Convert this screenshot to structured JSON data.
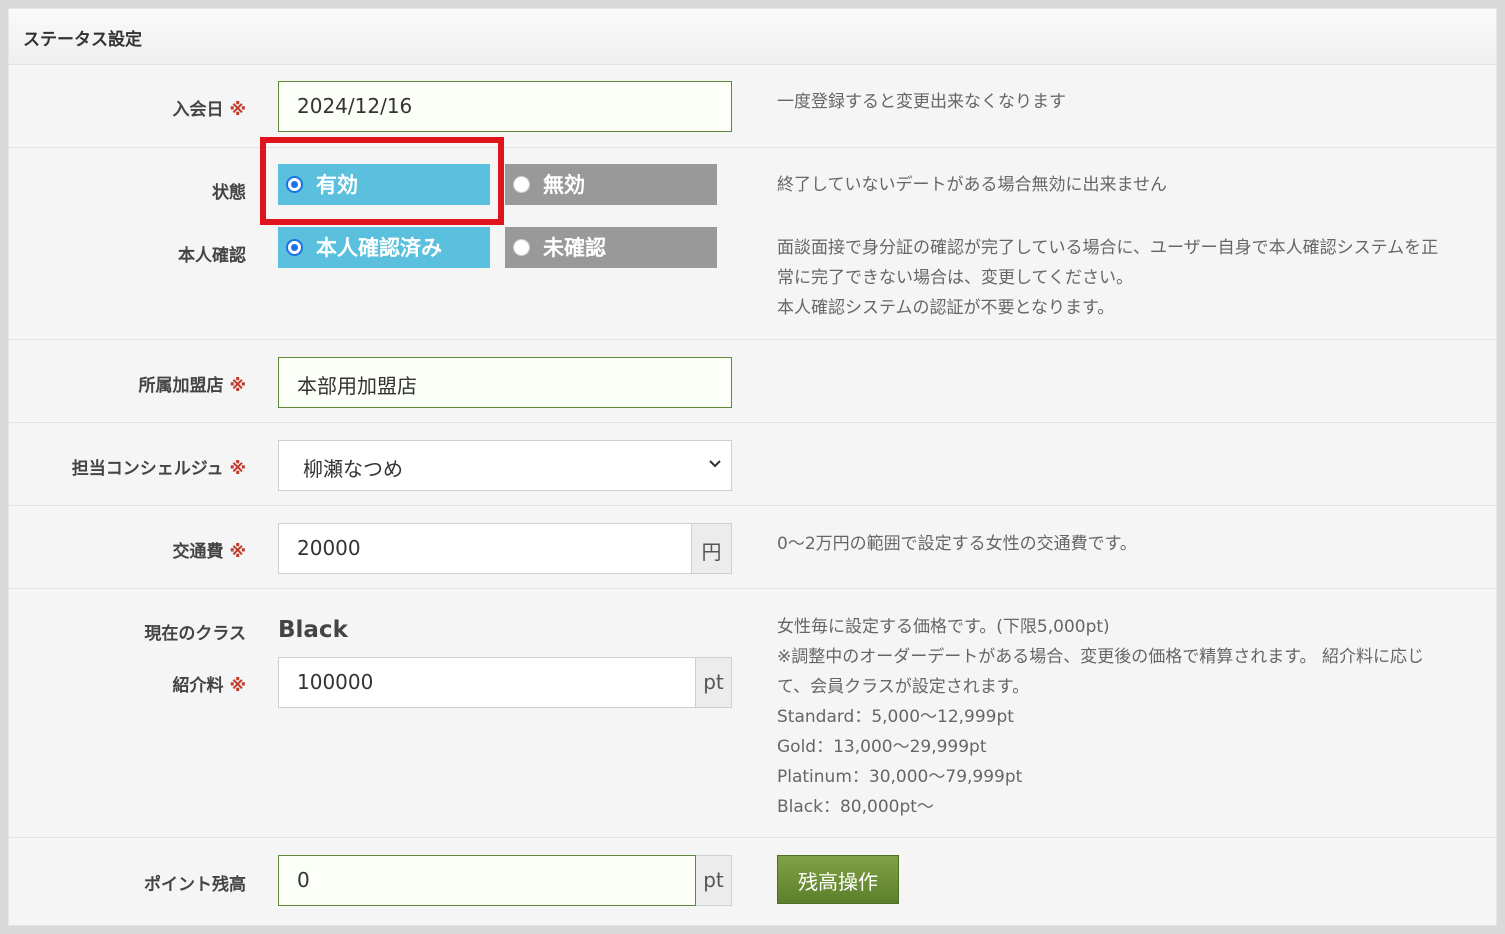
{
  "panel": {
    "title": "ステータス設定"
  },
  "required_mark": "※",
  "join_date": {
    "label": "入会日",
    "value": "2024/12/16",
    "note": "一度登録すると変更出来なくなります"
  },
  "status": {
    "label": "状態",
    "options": [
      {
        "label": "有効",
        "selected": true
      },
      {
        "label": "無効",
        "selected": false
      }
    ],
    "note": "終了していないデートがある場合無効に出来ません"
  },
  "identity": {
    "label": "本人確認",
    "options": [
      {
        "label": "本人確認済み",
        "selected": true
      },
      {
        "label": "未確認",
        "selected": false
      }
    ],
    "note_lines": [
      "面談面接で身分証の確認が完了している場合に、ユーザー自身で本人確認システムを正",
      "常に完了できない場合は、変更してください。",
      "本人確認システムの認証が不要となります。"
    ]
  },
  "store": {
    "label": "所属加盟店",
    "value": "本部用加盟店"
  },
  "concierge": {
    "label": "担当コンシェルジュ",
    "value": "柳瀬なつめ"
  },
  "transport": {
    "label": "交通費",
    "value": "20000",
    "unit": "円",
    "note": "0〜2万円の範囲で設定する女性の交通費です。"
  },
  "current_class": {
    "label": "現在のクラス",
    "value": "Black"
  },
  "fee": {
    "label": "紹介料",
    "value": "100000",
    "unit": "pt",
    "note_lines": [
      "女性毎に設定する価格です。(下限5,000pt)",
      "※調整中のオーダーデートがある場合、変更後の価格で精算されます。 紹介料に応じ",
      "て、会員クラスが設定されます。",
      "Standard：5,000〜12,999pt",
      "Gold：13,000〜29,999pt",
      "Platinum：30,000〜79,999pt",
      "Black：80,000pt〜"
    ]
  },
  "points": {
    "label": "ポイント残高",
    "value": "0",
    "unit": "pt",
    "button": "残高操作"
  },
  "colors": {
    "selected": "#5bc0de",
    "unselected": "#999999",
    "highlight": "#e0141c",
    "button": "#6b8f37",
    "required": "#c0392b"
  }
}
